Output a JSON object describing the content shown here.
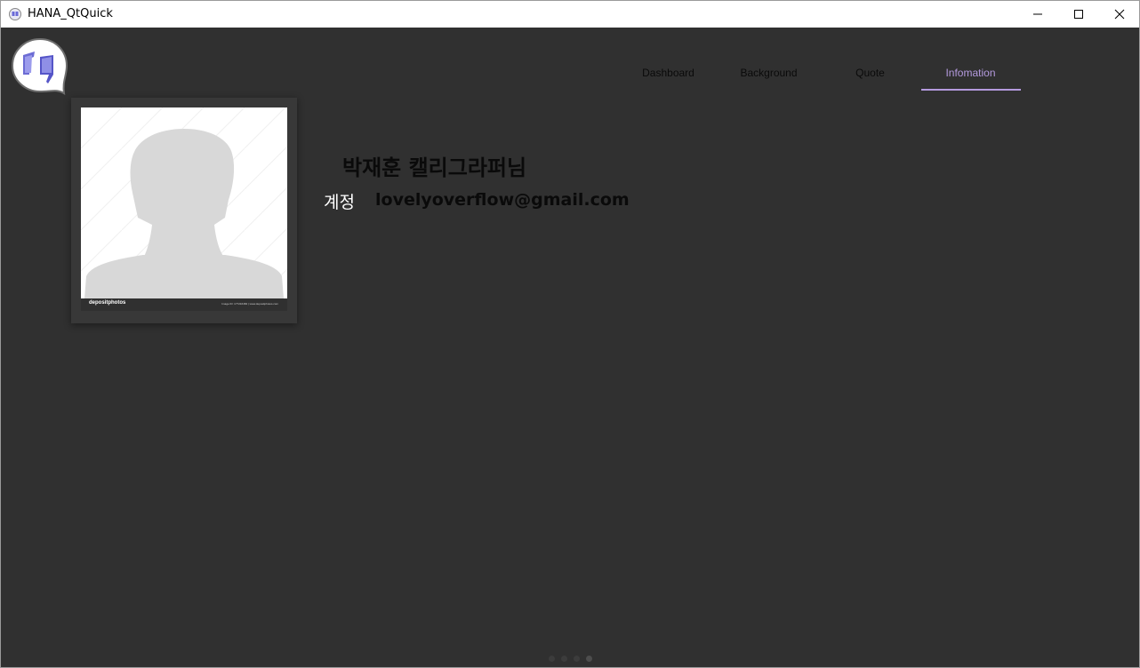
{
  "window": {
    "title": "HANA_QtQuick",
    "app_icon": "quote-bubble-icon",
    "controls": [
      "minimize-icon",
      "maximize-icon",
      "close-icon"
    ]
  },
  "colors": {
    "background": "#303030",
    "accent": "#b49ade",
    "titlebar": "#ffffff"
  },
  "logo": {
    "icon": "quote-bubble-icon"
  },
  "nav": {
    "tabs": [
      {
        "label": "Dashboard"
      },
      {
        "label": "Background"
      },
      {
        "label": "Quote"
      },
      {
        "label": "Infomation"
      }
    ],
    "active_index": 3
  },
  "profile": {
    "photo_watermark": "depositphotos",
    "photo_credit": "Image ID: 177216484 | www.depositphotos.com",
    "name": "박재훈 캘리그라퍼님",
    "account_label": "계정",
    "account_email": "lovelyoverflow@gmail.com"
  },
  "pager": {
    "count": 4,
    "active_index": 3
  }
}
